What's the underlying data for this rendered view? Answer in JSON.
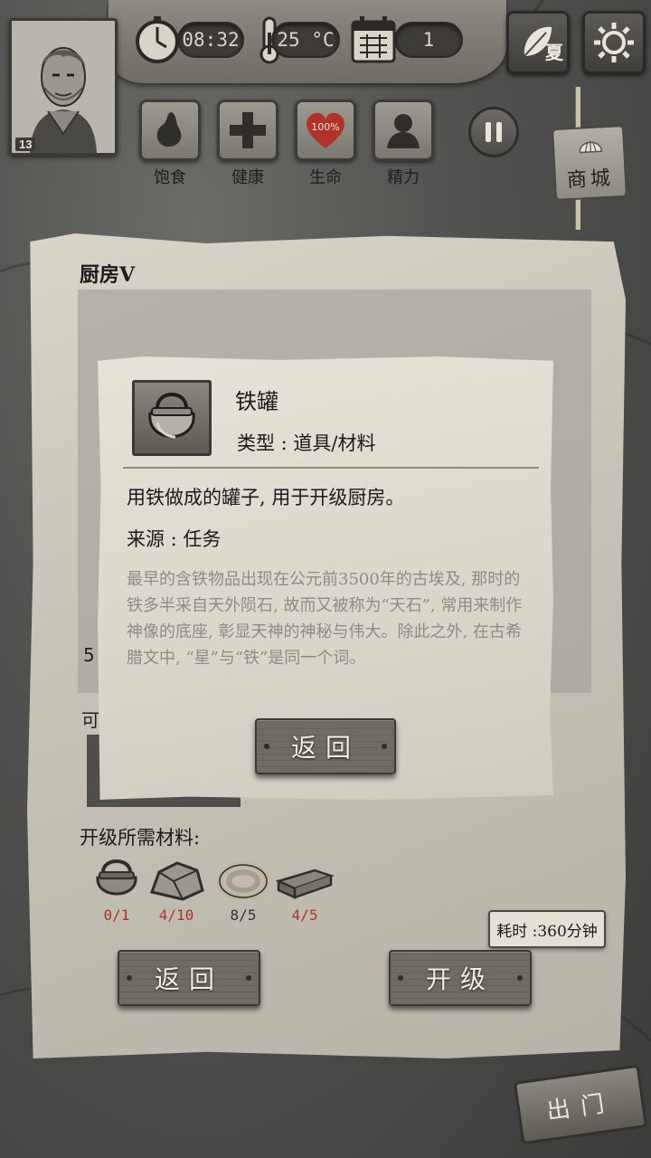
{
  "top": {
    "level": "13",
    "clock": "08:32",
    "temperature": "25 °C",
    "day": "1",
    "season": "夏"
  },
  "status": [
    {
      "label": "饱食",
      "icon": "stomach-icon"
    },
    {
      "label": "健康",
      "icon": "cross-icon"
    },
    {
      "label": "生命",
      "icon": "heart-icon",
      "value": "100%"
    },
    {
      "label": "精力",
      "icon": "person-icon"
    }
  ],
  "shop_label": "商城",
  "panel": {
    "title": "厨房V",
    "side_text_1": "5",
    "side_text_2": "可",
    "requirements_title": "开级所需材料:",
    "materials": [
      {
        "name": "iron-pot",
        "count": "0/1",
        "status": "missing"
      },
      {
        "name": "stone",
        "count": "4/10",
        "status": "missing"
      },
      {
        "name": "rope",
        "count": "8/5",
        "status": "ok"
      },
      {
        "name": "wood-plank",
        "count": "4/5",
        "status": "missing"
      }
    ],
    "time_cost": "耗时 :360分钟",
    "back_label": "返回",
    "upgrade_label": "开级"
  },
  "popup": {
    "name": "铁罐",
    "type": "类型 : 道具/材料",
    "description": "用铁做成的罐子, 用于开级厨房。",
    "source": "来源 : 任务",
    "lore": "最早的含铁物品出现在公元前3500年的古埃及, 那时的铁多半采自天外陨石, 故而又被称为“天石”, 常用来制作神像的底座, 彰显天神的神秘与伟大。除此之外, 在古希腊文中, “星”与“铁”是同一个词。",
    "back_label": "返回"
  },
  "exit_label": "出门",
  "colors": {
    "missing": "#b0322a",
    "parchment": "#d8d4ca",
    "plank": "#6f6c66"
  }
}
